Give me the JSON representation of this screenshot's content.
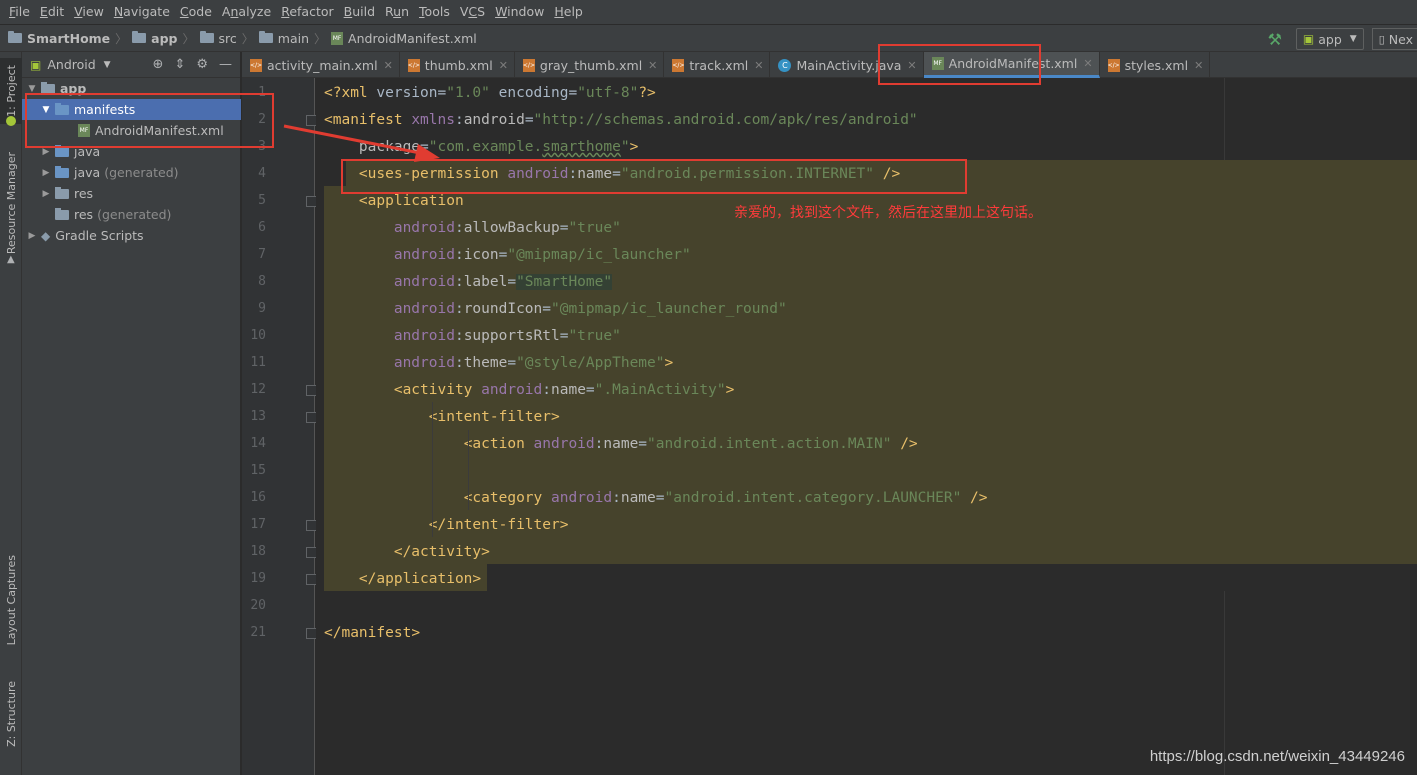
{
  "menu": [
    {
      "label": "File",
      "mnemonic_index": 0
    },
    {
      "label": "Edit",
      "mnemonic_index": 0
    },
    {
      "label": "View",
      "mnemonic_index": 0
    },
    {
      "label": "Navigate",
      "mnemonic_index": 0
    },
    {
      "label": "Code",
      "mnemonic_index": 0
    },
    {
      "label": "Analyze",
      "mnemonic_index": 1
    },
    {
      "label": "Refactor",
      "mnemonic_index": 0
    },
    {
      "label": "Build",
      "mnemonic_index": 0
    },
    {
      "label": "Run",
      "mnemonic_index": 1
    },
    {
      "label": "Tools",
      "mnemonic_index": 0
    },
    {
      "label": "VCS",
      "mnemonic_index": 1
    },
    {
      "label": "Window",
      "mnemonic_index": 0
    },
    {
      "label": "Help",
      "mnemonic_index": 0
    }
  ],
  "breadcrumb": {
    "project": "SmartHome",
    "module": "app",
    "src": "src",
    "main": "main",
    "file": "AndroidManifest.xml"
  },
  "toolbar": {
    "run_config": "app",
    "next_button": "Nex"
  },
  "tool_windows": {
    "project": "1: Project",
    "resource_manager": "Resource Manager",
    "layout_captures": "Layout Captures",
    "structure": "Z: Structure"
  },
  "project_panel": {
    "view_selector": "Android",
    "tree": {
      "app": "app",
      "manifests": "manifests",
      "manifest_file": "AndroidManifest.xml",
      "java": "java",
      "java_generated": "java",
      "java_generated_suffix": "(generated)",
      "res": "res",
      "res_generated": "res",
      "res_generated_suffix": "(generated)",
      "gradle_scripts": "Gradle Scripts"
    }
  },
  "tabs": [
    {
      "label": "activity_main.xml",
      "type": "xml",
      "active": false
    },
    {
      "label": "thumb.xml",
      "type": "xml",
      "active": false
    },
    {
      "label": "gray_thumb.xml",
      "type": "xml",
      "active": false
    },
    {
      "label": "track.xml",
      "type": "xml",
      "active": false
    },
    {
      "label": "MainActivity.java",
      "type": "java",
      "active": false
    },
    {
      "label": "AndroidManifest.xml",
      "type": "manifest",
      "active": true
    },
    {
      "label": "styles.xml",
      "type": "xml",
      "active": false
    }
  ],
  "editor": {
    "line_numbers": [
      "1",
      "2",
      "3",
      "4",
      "5",
      "6",
      "7",
      "8",
      "9",
      "10",
      "11",
      "12",
      "13",
      "14",
      "15",
      "16",
      "17",
      "18",
      "19",
      "20",
      "21"
    ],
    "lines": [
      "<?xml version=\"1.0\" encoding=\"utf-8\"?>",
      "<manifest xmlns:android=\"http://schemas.android.com/apk/res/android\"",
      "    package=\"com.example.smarthome\">",
      "    <uses-permission android:name=\"android.permission.INTERNET\" />",
      "    <application",
      "        android:allowBackup=\"true\"",
      "        android:icon=\"@mipmap/ic_launcher\"",
      "        android:label=\"SmartHome\"",
      "        android:roundIcon=\"@mipmap/ic_launcher_round\"",
      "        android:supportsRtl=\"true\"",
      "        android:theme=\"@style/AppTheme\">",
      "        <activity android:name=\".MainActivity\">",
      "            <intent-filter>",
      "                <action android:name=\"android.intent.action.MAIN\" />",
      "",
      "                <category android:name=\"android.intent.category.LAUNCHER\" />",
      "            </intent-filter>",
      "        </activity>",
      "    </application>",
      "",
      "</manifest>"
    ]
  },
  "annotation_text": "亲爱的，找到这个文件，然后在这里加上这句话。",
  "watermark": "https://blog.csdn.net/weixin_43449246",
  "colors": {
    "highlight_box": "#e03c31",
    "selection": "#4b6eaf",
    "annotation_text": "#ff3b3b"
  }
}
